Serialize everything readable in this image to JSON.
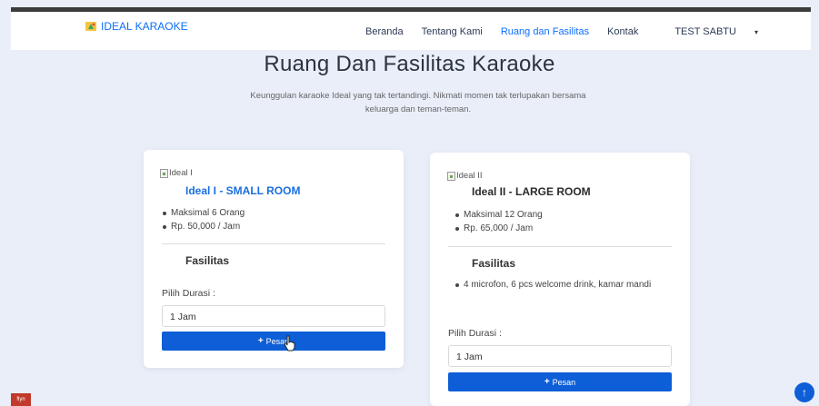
{
  "navbar": {
    "brand": "IDEAL KARAOKE",
    "links": [
      "Beranda",
      "Tentang Kami",
      "Ruang dan Fasilitas",
      "Kontak"
    ],
    "user": "TEST SABTU"
  },
  "page": {
    "title": "Ruang Dan Fasilitas Karaoke",
    "subtitle": "Keunggulan karaoke Ideal yang tak tertandingi. Nikmati momen tak terlupakan bersama keluarga dan teman-teman."
  },
  "rooms": [
    {
      "img_alt": "Ideal I",
      "title": "Ideal I - SMALL ROOM",
      "features": [
        "Maksimal 6 Orang",
        "Rp. 50,000 / Jam"
      ],
      "facilities_title": "Fasilitas",
      "facilities": [],
      "duration_label": "Pilih Durasi :",
      "duration_value": "1 Jam",
      "button": "Pesan"
    },
    {
      "img_alt": "Ideal II",
      "title": "Ideal II - LARGE ROOM",
      "features": [
        "Maksimal 12 Orang",
        "Rp. 65,000 / Jam"
      ],
      "facilities_title": "Fasilitas",
      "facilities": [
        "4 microfon, 6 pcs welcome drink, kamar mandi"
      ],
      "duration_label": "Pilih Durasi :",
      "duration_value": "1 Jam",
      "button": "Pesan"
    }
  ],
  "footer": {
    "scroll_top_icon": "arrow-up-icon",
    "corner_badge": "flyn"
  },
  "colors": {
    "accent": "#0d6efd",
    "button": "#0d5ed7",
    "user": "#e02020",
    "background": "#e9eef9"
  }
}
